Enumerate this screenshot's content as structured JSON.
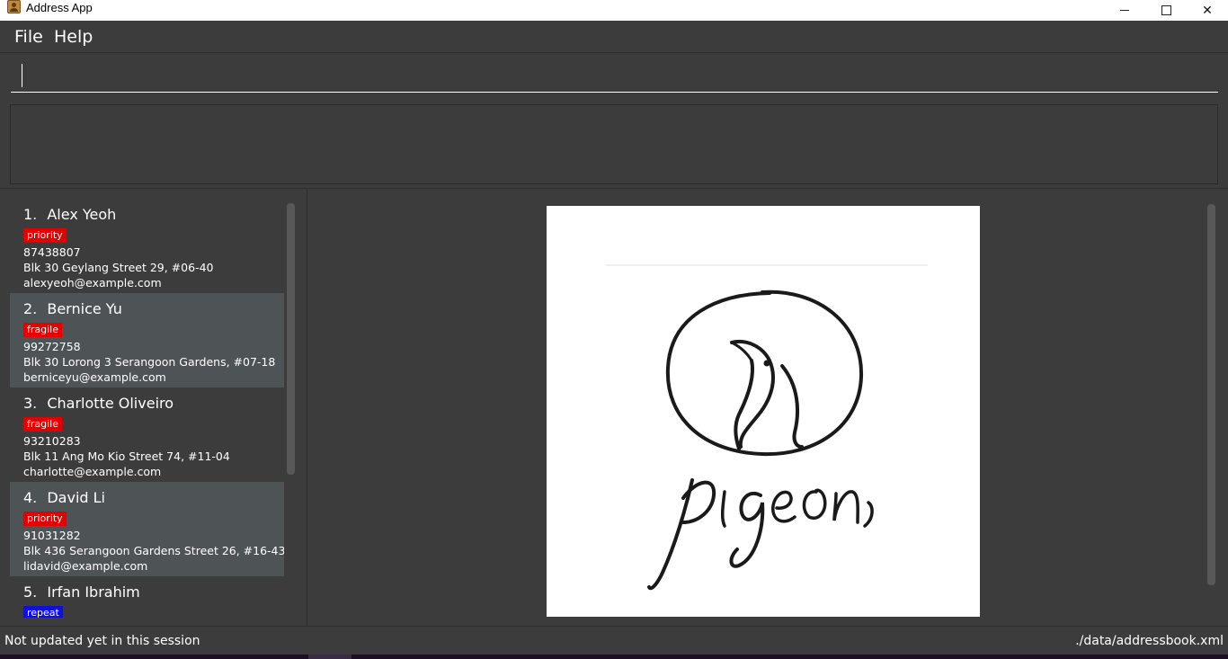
{
  "window": {
    "title": "Address App",
    "minimize_icon": "minimize-icon",
    "maximize_icon": "maximize-icon",
    "close_icon": "close-icon",
    "close_glyph": "✕"
  },
  "menu": {
    "items": [
      {
        "label": "File"
      },
      {
        "label": "Help"
      }
    ]
  },
  "command": {
    "value": "",
    "placeholder": ""
  },
  "result": {
    "text": ""
  },
  "persons": [
    {
      "index": "1.",
      "name": "Alex Yeoh",
      "tag": "priority",
      "tag_color": "#e30000",
      "phone": "87438807",
      "address": "Blk 30 Geylang Street 29, #06-40",
      "email": "alexyeoh@example.com"
    },
    {
      "index": "2.",
      "name": "Bernice Yu",
      "tag": "fragile",
      "tag_color": "#e30000",
      "phone": "99272758",
      "address": "Blk 30 Lorong 3 Serangoon Gardens, #07-18",
      "email": "berniceyu@example.com"
    },
    {
      "index": "3.",
      "name": "Charlotte Oliveiro",
      "tag": "fragile",
      "tag_color": "#e30000",
      "phone": "93210283",
      "address": "Blk 11 Ang Mo Kio Street 74, #11-04",
      "email": "charlotte@example.com"
    },
    {
      "index": "4.",
      "name": "David Li",
      "tag": "priority",
      "tag_color": "#e30000",
      "phone": "91031282",
      "address": "Blk 436 Serangoon Gardens Street 26, #16-43",
      "email": "lidavid@example.com"
    },
    {
      "index": "5.",
      "name": "Irfan Ibrahim",
      "tag": "repeat",
      "tag_color": "#1010dd",
      "phone": "",
      "address": "",
      "email": ""
    }
  ],
  "browser": {
    "logo_text": "pigeons",
    "logo_icon": "pigeon-logo-icon"
  },
  "status": {
    "sync": "Not updated yet in this session",
    "file_path": "./data/addressbook.xml"
  },
  "colors": {
    "background": "#3c3c3c",
    "card_alt": "#4e5356",
    "tag_red": "#e30000",
    "tag_blue": "#1010dd"
  }
}
